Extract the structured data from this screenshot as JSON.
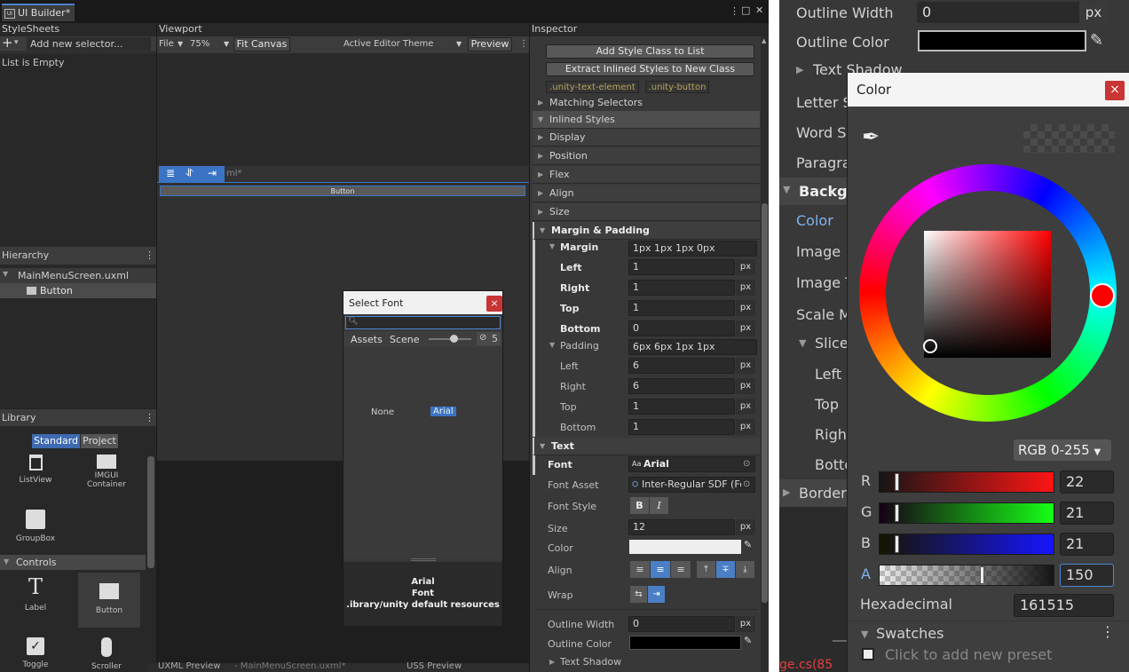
{
  "editor": {
    "tab_title": "UI Builder*",
    "tab_icon": "ui-builder-icon",
    "window_controls": [
      "⋮",
      "□",
      "✕"
    ],
    "stylesheets": {
      "header": "StyleSheets",
      "add_icon": "+",
      "add_dropdown_icon": "▾",
      "selector_placeholder": "Add new selector...",
      "empty_text": "List is Empty"
    },
    "viewport": {
      "header": "Viewport",
      "file_menu": "File",
      "zoom": "75%",
      "fit_canvas": "Fit Canvas",
      "theme": "Active Editor Theme",
      "preview": "Preview",
      "canvas_label": "ml*",
      "canvas_button": "Button"
    },
    "hierarchy": {
      "header": "Hierarchy",
      "root": "MainMenuScreen.uxml",
      "child": "Button"
    },
    "library": {
      "header": "Library",
      "tab_standard": "Standard",
      "tab_project": "Project",
      "items_row1": [
        "ListView",
        "IMGUI Container"
      ],
      "items_row2": [
        "GroupBox"
      ],
      "controls_header": "Controls",
      "controls_row1": [
        "Label",
        "Button"
      ],
      "controls_row2": [
        "Toggle",
        "Scroller"
      ]
    },
    "bottom_tabs": {
      "uxml_preview": "UXML Preview",
      "uxml_file": "- MainMenuScreen.uxml*",
      "uss_preview": "USS Preview"
    },
    "select_font": {
      "title": "Select Font",
      "close": "×",
      "search_value": "",
      "tab_assets": "Assets",
      "tab_scene": "Scene",
      "hidden_count": "5",
      "option_none": "None",
      "option_arial": "Arial",
      "selected_name": "Arial",
      "selected_type": "Font",
      "selected_path": ".ibrary/unity default resources"
    },
    "inspector": {
      "header": "Inspector",
      "add_style_class": "Add Style Class to List",
      "extract_styles": "Extract Inlined Styles to New Class",
      "class_chips": [
        ".unity-text-element",
        ".unity-button"
      ],
      "matching_selectors": "Matching Selectors",
      "inlined_styles": "Inlined Styles",
      "sections": [
        "Display",
        "Position",
        "Flex",
        "Align",
        "Size"
      ],
      "margin_padding": "Margin & Padding",
      "margin_label": "Margin",
      "margin_value": "1px 1px 1px 0px",
      "margin_fields": [
        {
          "label": "Left",
          "value": "1",
          "unit": "px"
        },
        {
          "label": "Right",
          "value": "1",
          "unit": "px"
        },
        {
          "label": "Top",
          "value": "1",
          "unit": "px"
        },
        {
          "label": "Bottom",
          "value": "0",
          "unit": "px"
        }
      ],
      "padding_label": "Padding",
      "padding_value": "6px 6px 1px 1px",
      "padding_fields": [
        {
          "label": "Left",
          "value": "6",
          "unit": "px"
        },
        {
          "label": "Right",
          "value": "6",
          "unit": "px"
        },
        {
          "label": "Top",
          "value": "1",
          "unit": "px"
        },
        {
          "label": "Bottom",
          "value": "1",
          "unit": "px"
        }
      ],
      "text_header": "Text",
      "font_label": "Font",
      "font_value": "Arial",
      "font_asset_label": "Font Asset",
      "font_asset_value": "Inter-Regular SDF (Fo",
      "font_style_label": "Font Style",
      "font_style_b": "B",
      "font_style_i": "I",
      "size_label": "Size",
      "size_value": "12",
      "size_unit": "px",
      "color_label": "Color",
      "align_label": "Align",
      "wrap_label": "Wrap",
      "outline_width_label": "Outline Width",
      "outline_width_value": "0",
      "outline_width_unit": "px",
      "outline_color_label": "Outline Color",
      "text_shadow_label": "Text Shadow"
    }
  },
  "right": {
    "outline_width_label": "Outline Width",
    "outline_width_value": "0",
    "outline_width_unit": "px",
    "outline_color_label": "Outline Color",
    "text_shadow_label": "Text Shadow",
    "rows": [
      "Letter S",
      "Word Sp",
      "Paragra"
    ],
    "background_header": "Backgr",
    "color_label": "Color",
    "image_label": "Image",
    "image_t_label": "Image T",
    "scale_label": "Scale M",
    "slice_label": "Slice",
    "slice_fields": [
      "Left",
      "Top",
      "Right",
      "Botto"
    ],
    "border_label": "Border",
    "error_text": "ge.cs(85"
  },
  "color_picker": {
    "title": "Color",
    "close": "×",
    "mode": "RGB 0-255",
    "channels": [
      {
        "label": "R",
        "value": "22",
        "fraction": 0.086
      },
      {
        "label": "G",
        "value": "21",
        "fraction": 0.082
      },
      {
        "label": "B",
        "value": "21",
        "fraction": 0.082
      },
      {
        "label": "A",
        "value": "150",
        "fraction": 0.588
      }
    ],
    "hex_label": "Hexadecimal",
    "hex_value": "161515",
    "swatches_label": "Swatches",
    "swatches_hint": "Click to add new preset",
    "accent_color": "#4b88d4",
    "close_color": "#c93434"
  }
}
